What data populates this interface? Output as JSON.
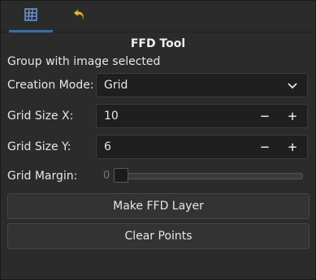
{
  "tabs": [
    {
      "icon": "grid-icon",
      "active": true
    },
    {
      "icon": "undo-icon",
      "active": false
    }
  ],
  "title": "FFD Tool",
  "status": "Group with image selected",
  "creation_mode": {
    "label": "Creation Mode:",
    "value": "Grid"
  },
  "grid_size_x": {
    "label": "Grid Size X:",
    "value": "10"
  },
  "grid_size_y": {
    "label": "Grid Size Y:",
    "value": "6"
  },
  "grid_margin": {
    "label": "Grid Margin:",
    "value": "0",
    "level": 0
  },
  "buttons": {
    "make": "Make FFD Layer",
    "clear": "Clear Points"
  },
  "colors": {
    "accent": "#3b6ea5",
    "background": "#2b2b2b"
  }
}
